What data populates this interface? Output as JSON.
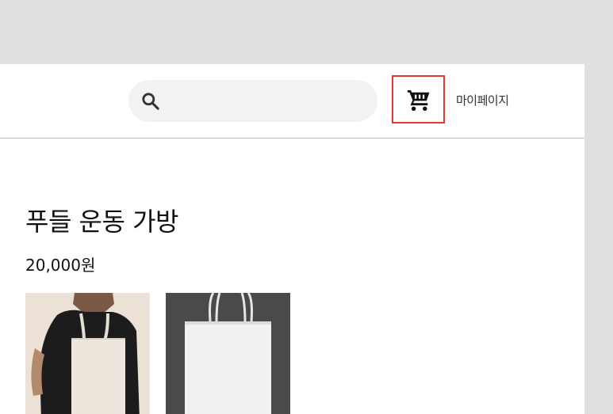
{
  "header": {
    "search": {
      "icon": "search-icon",
      "placeholder": ""
    },
    "cart": {
      "icon": "shopping-cart-icon",
      "highlight_color": "#e53935"
    },
    "mypage_label": "마이페이지"
  },
  "product": {
    "title": "푸들 운동 가방",
    "price": "20,000원",
    "images": [
      {
        "name": "person-carrying-tote-bag"
      },
      {
        "name": "white-tote-bag-on-dark-background"
      }
    ]
  }
}
